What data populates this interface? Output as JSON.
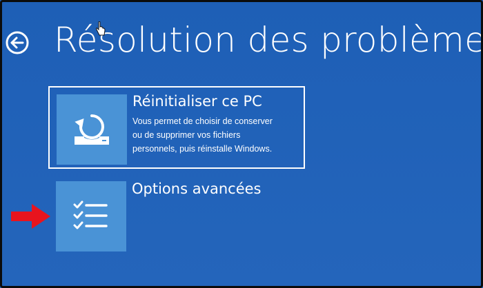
{
  "screen": {
    "title": "Résolution des problèmes",
    "background_color": "#1f61b8",
    "tile_icon_color": "#4a93d6"
  },
  "back_button": {
    "icon": "back-arrow-icon"
  },
  "options": [
    {
      "title": "Réinitialiser ce PC",
      "description": "Vous permet de choisir de conserver\nou de supprimer vos fichiers\npersonnels, puis réinstalle Windows.",
      "icon": "reset-pc-icon",
      "selected": true
    },
    {
      "title": "Options avancées",
      "description": "",
      "icon": "checklist-icon",
      "selected": false
    }
  ],
  "annotation": {
    "arrow_color": "#e8141e",
    "icon": "red-arrow-icon"
  },
  "cursor": {
    "icon": "hand-cursor-icon"
  }
}
